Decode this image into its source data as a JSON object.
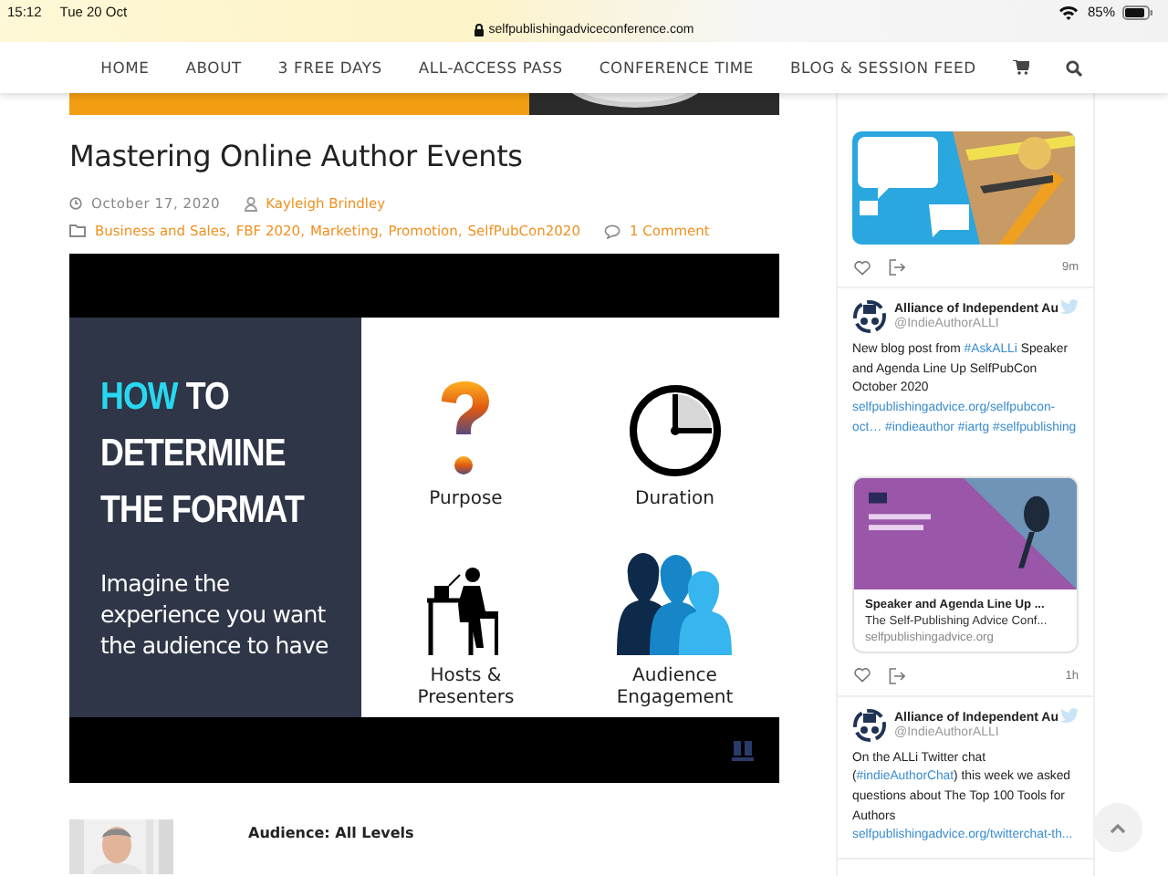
{
  "status_bar": {
    "time": "15:12",
    "date": "Tue 20 Oct",
    "battery": "85%"
  },
  "address_bar": {
    "url": "selfpublishingadviceconference.com"
  },
  "nav": {
    "items": [
      "HOME",
      "ABOUT",
      "3 FREE DAYS",
      "ALL-ACCESS PASS",
      "CONFERENCE TIME",
      "BLOG & SESSION FEED"
    ]
  },
  "post": {
    "title": "Mastering Online Author Events",
    "date": "October 17, 2020",
    "author": "Kayleigh Brindley",
    "categories": [
      "Business and Sales",
      "FBF 2020",
      "Marketing",
      "Promotion",
      "SelfPubCon2020"
    ],
    "separator": ",",
    "comments": "1 Comment"
  },
  "slide": {
    "heading_accent": "HOW",
    "heading_lines": [
      "TO",
      "DETERMINE",
      "THE FORMAT"
    ],
    "tagline": "Imagine the experience you want the audience to have",
    "factors": [
      {
        "kind": "question",
        "label": "Purpose"
      },
      {
        "kind": "clock",
        "label": "Duration"
      },
      {
        "kind": "presenter",
        "label": "Hosts & Presenters"
      },
      {
        "kind": "audience",
        "label": "Audience Engagement"
      }
    ]
  },
  "audience_label": "Audience: All Levels",
  "tweets": [
    {
      "kind": "media",
      "time": "9m"
    },
    {
      "kind": "card",
      "author": "Alliance of Independent Au",
      "handle": "@IndieAuthorALLI",
      "text": [
        {
          "kind": "plain",
          "text": "New blog post from"
        },
        {
          "kind": "link",
          "text": "#AskALLi"
        },
        {
          "kind": "plain",
          "text": "Speaker and Agenda Line Up SelfPubCon October 2020"
        },
        {
          "kind": "link",
          "text": "selfpublishingadvice.org/selfpubcon-"
        },
        {
          "kind": "link",
          "text": "oct…"
        },
        {
          "kind": "link",
          "text": "#indieauthor"
        },
        {
          "kind": "link",
          "text": "#iartg"
        },
        {
          "kind": "link",
          "text": "#selfpublishing"
        }
      ],
      "card": {
        "title": "Speaker and Agenda Line Up ...",
        "description": "The Self-Publishing Advice Conf...",
        "domain": "selfpublishingadvice.org"
      },
      "time": "1h"
    },
    {
      "kind": "text",
      "author": "Alliance of Independent Au",
      "handle": "@IndieAuthorALLI",
      "text": [
        {
          "kind": "plain",
          "text": "On the ALLi Twitter chat ("
        },
        {
          "kind": "link",
          "text": "#indieAuthorChat"
        },
        {
          "kind": "plain",
          "text": ") this week we asked questions about The Top 100 Tools for Authors"
        },
        {
          "kind": "link",
          "text": "selfpublishingadvice.org/twitterchat-th..."
        }
      ]
    }
  ]
}
